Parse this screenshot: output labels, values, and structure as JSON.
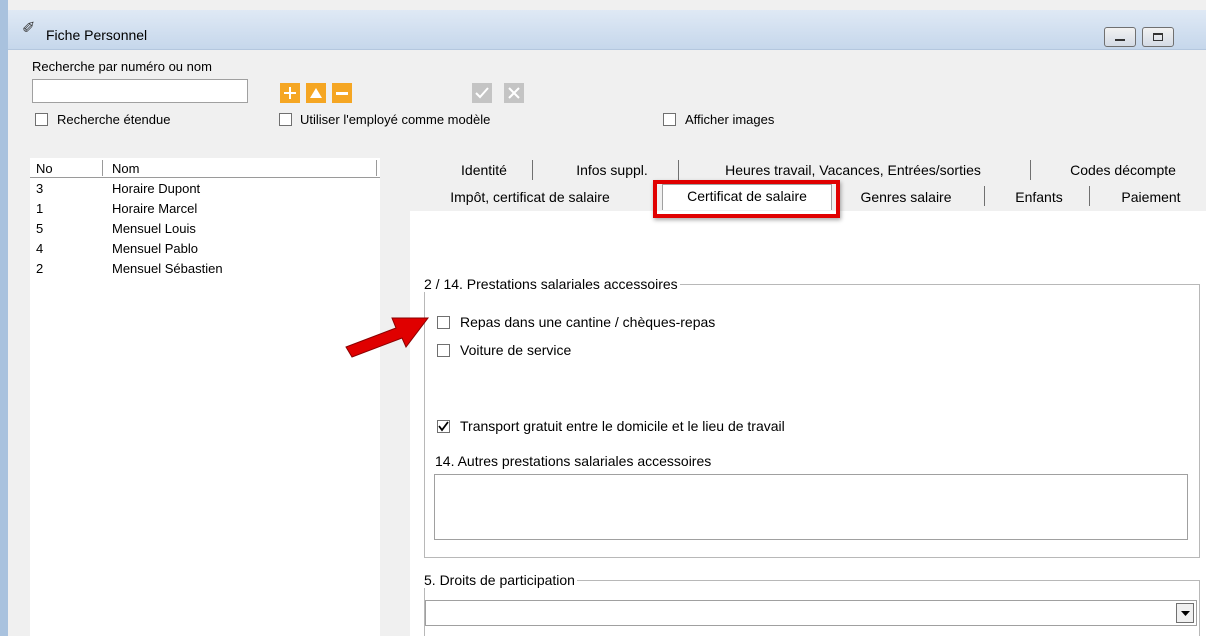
{
  "window": {
    "title": "Fiche Personnel",
    "icon": "pen-icon",
    "minimize_icon": "minimize-icon",
    "maximize_icon": "maximize-icon"
  },
  "search": {
    "label": "Recherche par numéro ou nom",
    "value": "",
    "placeholder": "",
    "extended_label": "Recherche étendue",
    "extended_checked": false
  },
  "toolbar": {
    "add_icon": "plus-icon",
    "up_icon": "triangle-up-icon",
    "remove_icon": "minus-icon",
    "confirm_icon": "checkmark-icon",
    "cancel_icon": "x-icon",
    "accent_color": "#f5a623"
  },
  "options": {
    "template_label": "Utiliser l'employé comme modèle",
    "template_checked": false,
    "images_label": "Afficher images",
    "images_checked": false
  },
  "employee_list": {
    "columns": [
      "No",
      "Nom"
    ],
    "rows": [
      {
        "no": "3",
        "name": "Horaire Dupont"
      },
      {
        "no": "1",
        "name": "Horaire Marcel"
      },
      {
        "no": "5",
        "name": "Mensuel Louis"
      },
      {
        "no": "4",
        "name": "Mensuel Pablo"
      },
      {
        "no": "2",
        "name": "Mensuel Sébastien"
      }
    ]
  },
  "tabs": {
    "row1": [
      "Identité",
      "Infos suppl.",
      "Heures travail, Vacances, Entrées/sorties",
      "Codes décompte"
    ],
    "row2": [
      "Impôt, certificat de salaire",
      "Certificat de salaire",
      "Genres salaire",
      "Enfants",
      "Paiement"
    ],
    "active": "Certificat de salaire",
    "highlight_color": "#e00000"
  },
  "benefits": {
    "title": "2 / 14. Prestations salariales accessoires",
    "items": [
      {
        "label": "Repas dans une cantine / chèques-repas",
        "checked": false
      },
      {
        "label": "Voiture de service",
        "checked": false
      },
      {
        "label": "Transport gratuit entre le domicile et le lieu de travail",
        "checked": true
      }
    ],
    "other_label": "14. Autres prestations salariales accessoires",
    "other_value": ""
  },
  "participation": {
    "title": "5. Droits de participation",
    "selected": "",
    "dropdown_icon": "chevron-down-icon"
  },
  "annotation": {
    "arrow_icon": "red-arrow-icon",
    "arrow_color": "#e00000"
  }
}
